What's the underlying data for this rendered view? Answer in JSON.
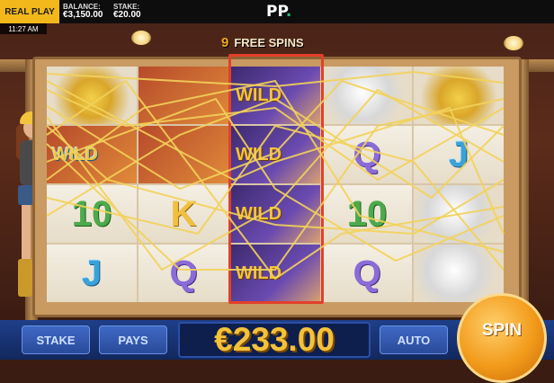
{
  "topbar": {
    "mode_label": "REAL PLAY",
    "balance_label": "BALANCE:",
    "balance_value": "€3,150.00",
    "stake_label": "STAKE:",
    "stake_value": "€20.00",
    "logo_text": "PP",
    "logo_dot": ".",
    "time": "11:27 AM"
  },
  "free_spins": {
    "count": "9",
    "label": "FREE SPINS"
  },
  "reels": [
    [
      {
        "t": "",
        "c": "nugget"
      },
      {
        "t": "WILD",
        "c": "gold"
      },
      {
        "t": "10",
        "c": "ten"
      },
      {
        "t": "J",
        "c": "j"
      }
    ],
    [
      {
        "t": "",
        "c": "gold"
      },
      {
        "t": "",
        "c": "gold"
      },
      {
        "t": "K",
        "c": "k"
      },
      {
        "t": "Q",
        "c": "q"
      }
    ],
    [
      {
        "t": "WILD",
        "c": "wild"
      },
      {
        "t": "WILD",
        "c": "wild"
      },
      {
        "t": "WILD",
        "c": "wild"
      },
      {
        "t": "WILD",
        "c": "wild"
      }
    ],
    [
      {
        "t": "",
        "c": "helmet"
      },
      {
        "t": "Q",
        "c": "q"
      },
      {
        "t": "10",
        "c": "ten"
      },
      {
        "t": "Q",
        "c": "q"
      }
    ],
    [
      {
        "t": "",
        "c": "nugget"
      },
      {
        "t": "J",
        "c": "j"
      },
      {
        "t": "",
        "c": "helmet"
      },
      {
        "t": "",
        "c": "helmet"
      }
    ]
  ],
  "bottombar": {
    "stake_label": "STAKE",
    "pays_label": "PAYS",
    "win_amount": "€233.00",
    "auto_label": "AUTO",
    "spin_label": "SPIN"
  },
  "colors": {
    "real_play_bg": "#f2b81b",
    "win_text": "#f4c23a",
    "reel_highlight": "#e2402a",
    "paylines": "#f2d25a"
  }
}
